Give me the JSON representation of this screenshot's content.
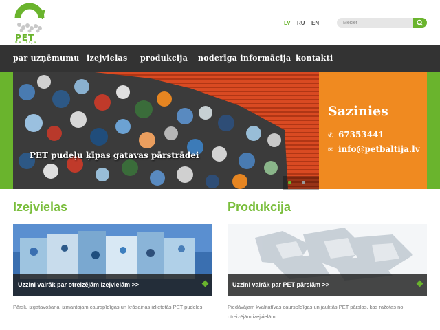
{
  "brand": {
    "logo_text": "PET",
    "logo_sub": "BALTIJA",
    "accent": "#6ab42d",
    "contact_bg": "#f08a20",
    "nav_bg": "#333333"
  },
  "languages": [
    {
      "label": "LV",
      "active": true
    },
    {
      "label": "RU",
      "active": false
    },
    {
      "label": "EN",
      "active": false
    }
  ],
  "search": {
    "placeholder": "Meklēt",
    "icon": "search-icon"
  },
  "nav": [
    {
      "label": "par uzņēmumu"
    },
    {
      "label": "izejvielas"
    },
    {
      "label": "produkcija"
    },
    {
      "label": "noderīga informācija"
    },
    {
      "label": "kontakti"
    }
  ],
  "hero": {
    "caption": "PET pudeļu ķīpas gatavas pārstrādei",
    "slide_count": 2,
    "active_slide": 0
  },
  "contact": {
    "title": "Sazinies",
    "phone": "67353441",
    "email": "info@petbaltija.lv",
    "phone_icon": "phone-icon",
    "email_icon": "envelope-icon"
  },
  "sections": [
    {
      "title": "Izejvielas",
      "cta": "Uzzini vairāk par otreizējām izejvielām >>",
      "desc": "Pārslu izgatavošanai izmantojam caurspīdīgas un krāsainas izlietotās PET pudeles"
    },
    {
      "title": "Produkcija",
      "cta": "Uzzini vairāk par PET pārslām >>",
      "desc": "Piedāvājam kvalitatīvas caurspīdīgas un jauktās PET pārslas, kas ražotas no otreizējām izejvielām"
    }
  ]
}
